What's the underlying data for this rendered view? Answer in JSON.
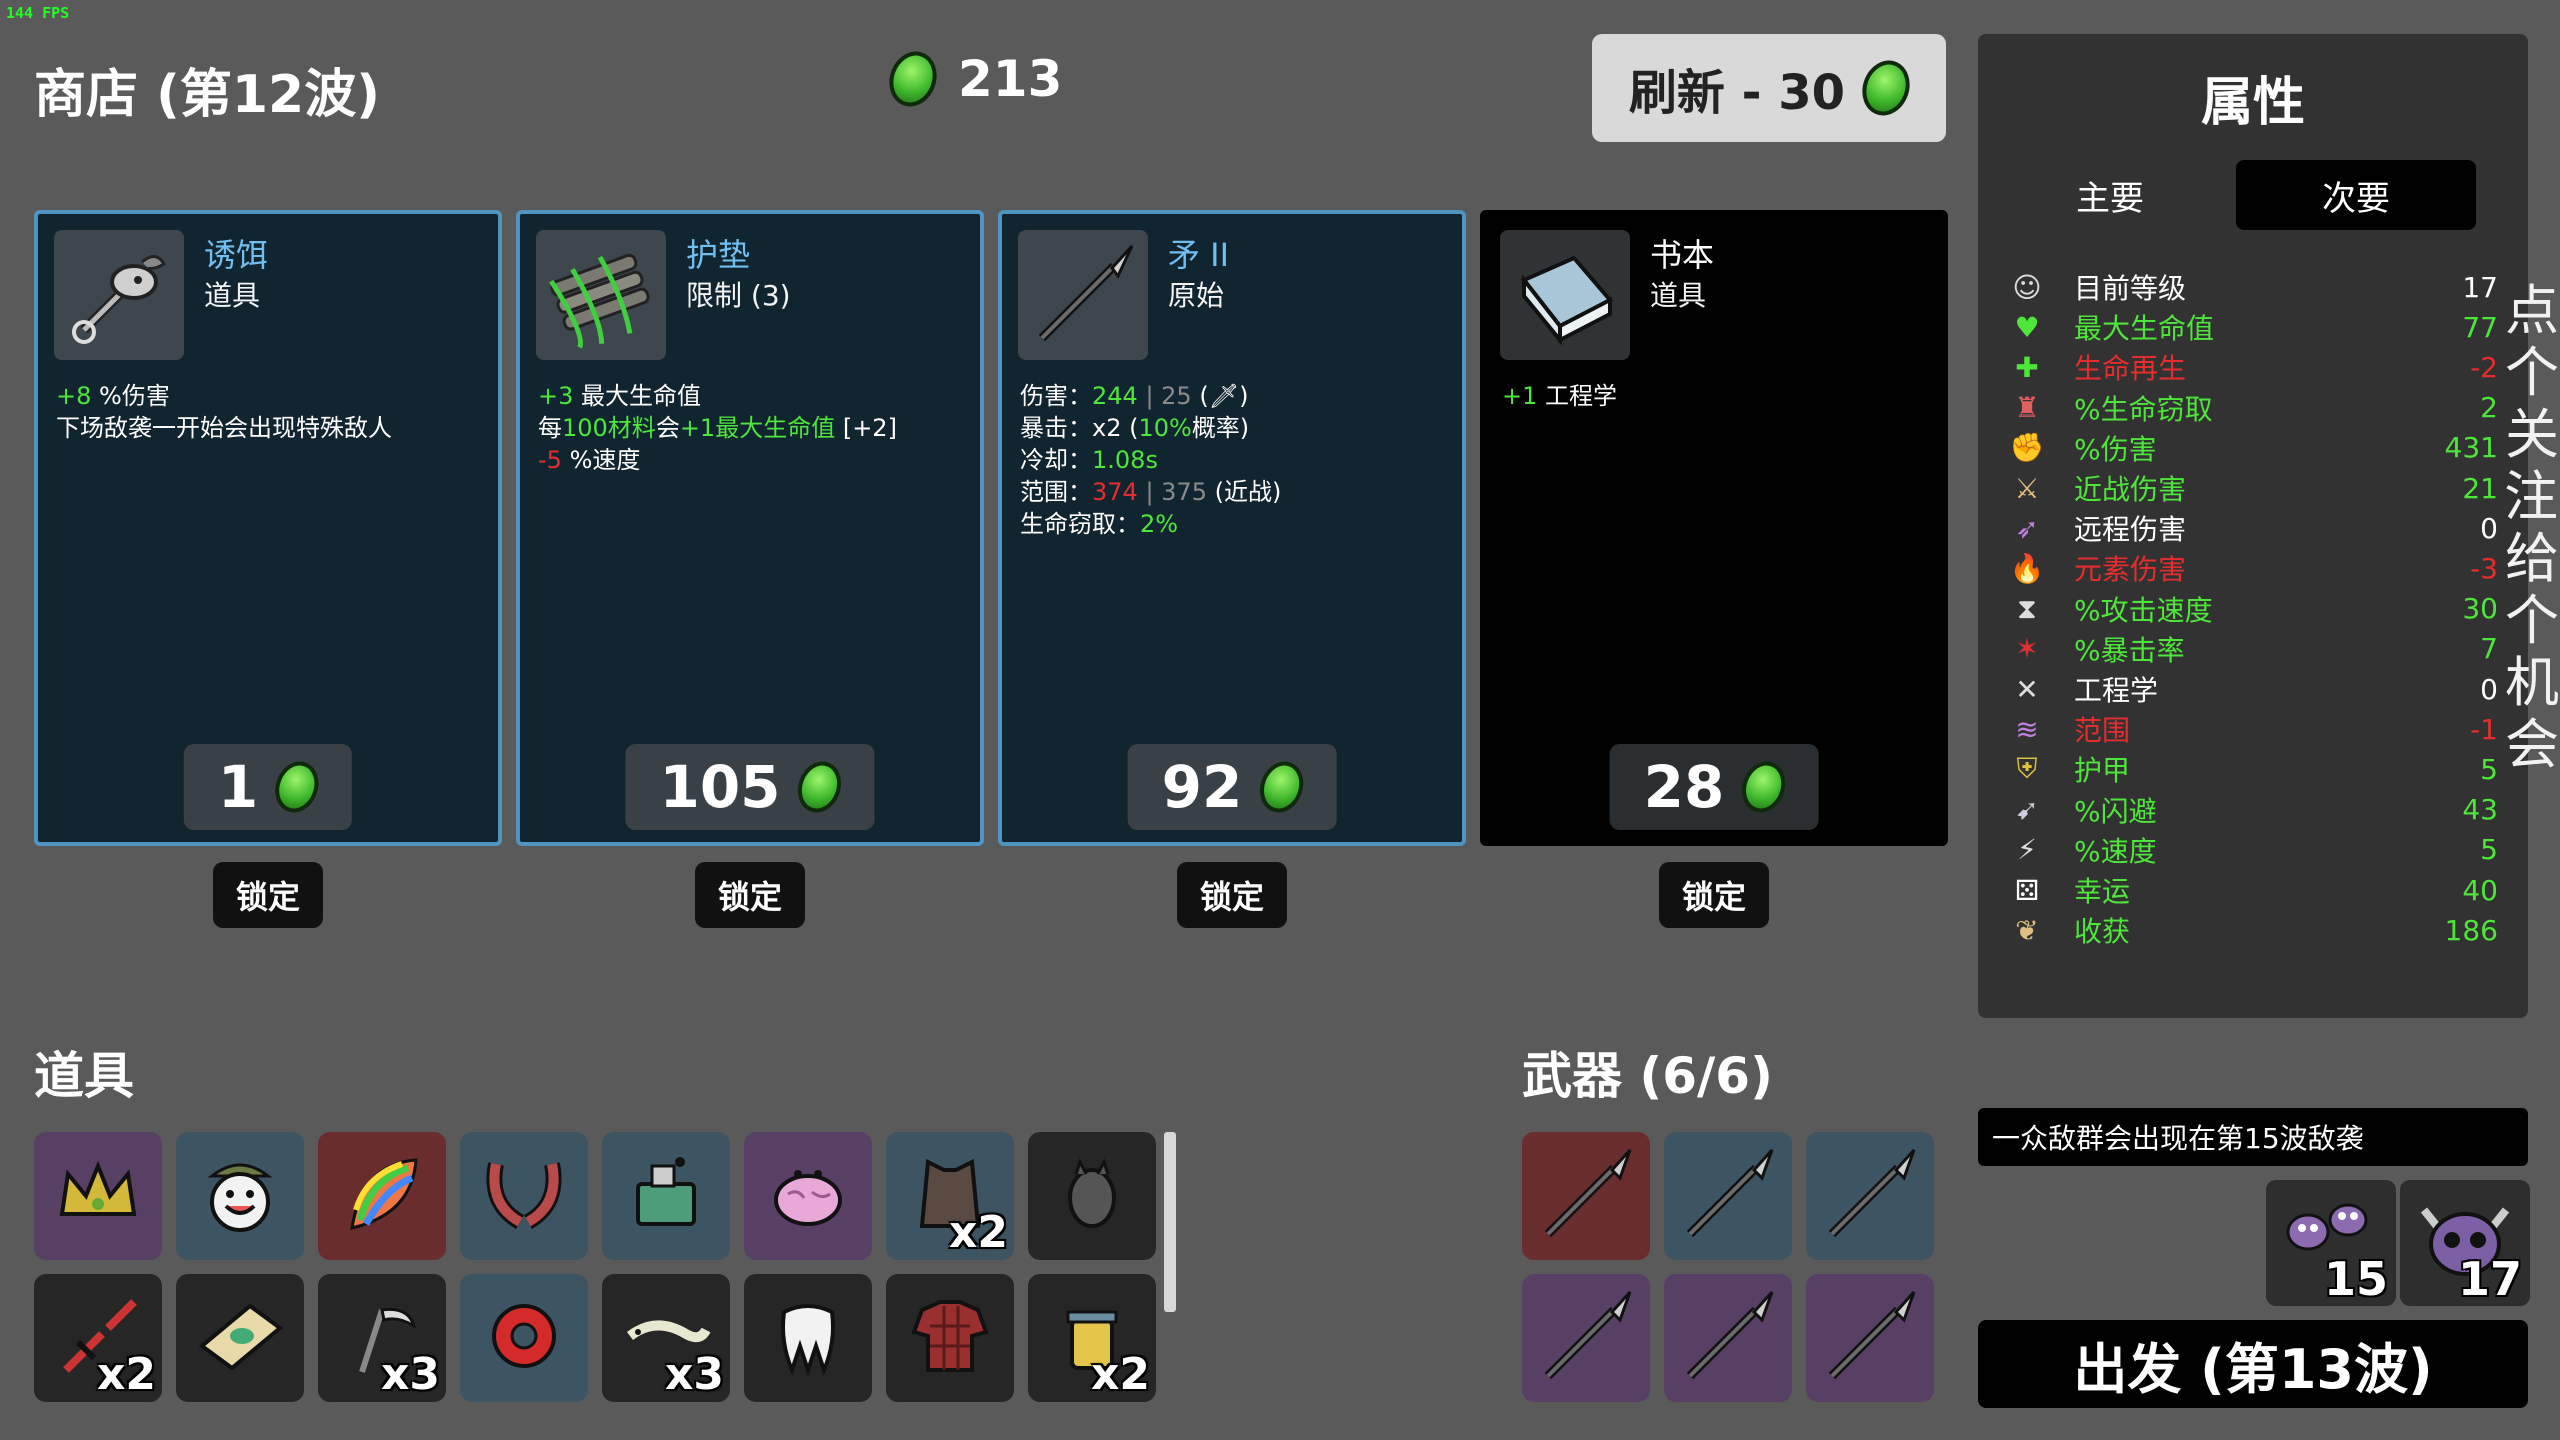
{
  "fps": "144 FPS",
  "shop": {
    "title": "商店 (第12波)",
    "materials": "213"
  },
  "reroll": {
    "label": "刷新 - 30"
  },
  "cards": [
    {
      "name": "诱饵",
      "type": "道具",
      "price": "1",
      "lock": "锁定",
      "lines": {
        "l1a": "+8",
        "l1b": " %伤害",
        "l2": "下场敌袭一开始会出现特殊敌人"
      }
    },
    {
      "name": "护垫",
      "type": "限制 (3)",
      "price": "105",
      "lock": "锁定",
      "lines": {
        "l1a": "+3",
        "l1b": " 最大生命值",
        "l2a": "每",
        "l2b": "100材料",
        "l2c": "会",
        "l2d": "+1最大生命值",
        "l2e": " [+2]",
        "l3a": "-5",
        "l3b": " %速度"
      }
    },
    {
      "name": "矛 II",
      "type": "原始",
      "price": "92",
      "lock": "锁定",
      "lines": {
        "dmg_k": "伤害：",
        "dmg_v": "244",
        "dmg_sep": " | ",
        "dmg_base": "25",
        "dmg_tail": " (🗡)",
        "crit_k": "暴击：",
        "crit_v": "x2 (",
        "crit_p": "10%",
        "crit_t": "概率)",
        "cd_k": "冷却：",
        "cd_v": "1.08s",
        "range_k": "范围：",
        "range_v": "374",
        "range_sep": " | ",
        "range_base": "375",
        "range_t": " (近战)",
        "ls_k": "生命窃取：",
        "ls_v": "2%"
      }
    },
    {
      "name": "书本",
      "type": "道具",
      "price": "28",
      "lock": "锁定",
      "lines": {
        "l1a": "+1",
        "l1b": " 工程学"
      }
    }
  ],
  "items_section": {
    "title": "道具"
  },
  "items": [
    {
      "icon": "crown-icon",
      "qty": ""
    },
    {
      "icon": "smiling-face-icon",
      "qty": ""
    },
    {
      "icon": "rainbow-leaf-icon",
      "qty": ""
    },
    {
      "icon": "claws-icon",
      "qty": ""
    },
    {
      "icon": "machine-icon",
      "qty": ""
    },
    {
      "icon": "brain-icon",
      "qty": ""
    },
    {
      "icon": "vest-icon",
      "qty": "x2"
    },
    {
      "icon": "bat-icon",
      "qty": ""
    },
    {
      "icon": "broken-sword-icon",
      "qty": "x2"
    },
    {
      "icon": "treasure-map-icon",
      "qty": ""
    },
    {
      "icon": "scythe-icon",
      "qty": "x3"
    },
    {
      "icon": "target-ring-icon",
      "qty": ""
    },
    {
      "icon": "lizard-icon",
      "qty": "x3"
    },
    {
      "icon": "tooth-icon",
      "qty": ""
    },
    {
      "icon": "plaid-shirt-icon",
      "qty": ""
    },
    {
      "icon": "jar-icon",
      "qty": "x2"
    }
  ],
  "weapons_section": {
    "title": "武器 (6/6)"
  },
  "weapons": [
    {
      "icon": "spear-icon"
    },
    {
      "icon": "spear-icon"
    },
    {
      "icon": "spear-icon"
    },
    {
      "icon": "spear-icon"
    },
    {
      "icon": "spear-icon"
    },
    {
      "icon": "spear-icon"
    }
  ],
  "stats": {
    "title": "属性",
    "tab_primary": "主要",
    "tab_secondary": "次要",
    "rows": [
      {
        "label": "目前等级",
        "value": "17"
      },
      {
        "label": "最大生命值",
        "value": "77"
      },
      {
        "label": "生命再生",
        "value": "-2"
      },
      {
        "label": "%生命窃取",
        "value": "2"
      },
      {
        "label": "%伤害",
        "value": "431"
      },
      {
        "label": "近战伤害",
        "value": "21"
      },
      {
        "label": "远程伤害",
        "value": "0"
      },
      {
        "label": "元素伤害",
        "value": "-3"
      },
      {
        "label": "%攻击速度",
        "value": "30"
      },
      {
        "label": "%暴击率",
        "value": "7"
      },
      {
        "label": "工程学",
        "value": "0"
      },
      {
        "label": "范围",
        "value": "-1"
      },
      {
        "label": "护甲",
        "value": "5"
      },
      {
        "label": "%闪避",
        "value": "43"
      },
      {
        "label": "%速度",
        "value": "5"
      },
      {
        "label": "幸运",
        "value": "40"
      },
      {
        "label": "收获",
        "value": "186"
      }
    ]
  },
  "overlay_text": "点个关注，给个机会",
  "wave_info": "一众敌群会出现在第15波敌袭",
  "enemies": [
    {
      "qty": "15"
    },
    {
      "qty": "17"
    }
  ],
  "go_button": "出发 (第13波)",
  "colors": {
    "positive": "#4ee63a",
    "negative": "#e62d2d",
    "card_border": "#4f95c2",
    "card_bg": "#112531"
  }
}
